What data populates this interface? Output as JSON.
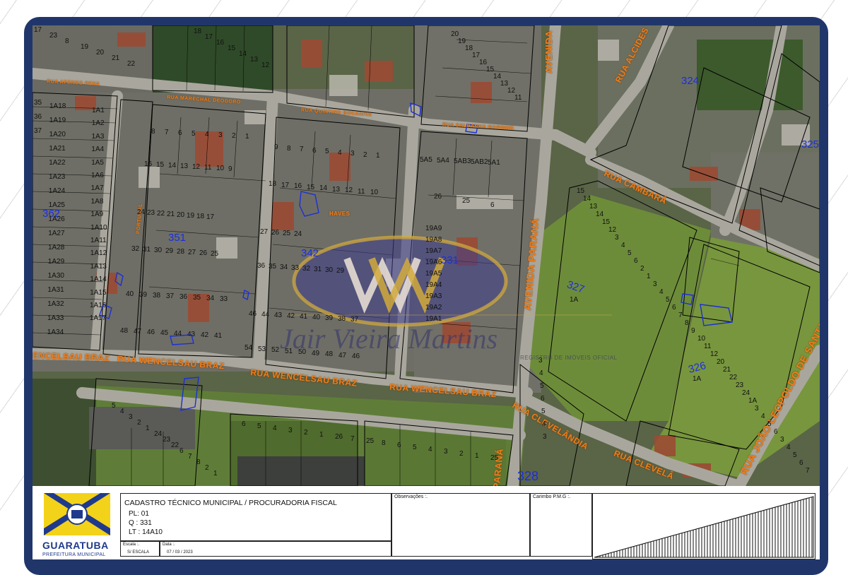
{
  "map": {
    "streets": [
      {
        "id": "rua-afonso-pena-top",
        "text": "RUA AFONSO PENA"
      },
      {
        "id": "rua-marechal",
        "text": "RUA MARECHAL DEODORO"
      },
      {
        "id": "rua-quintino",
        "text": "RUA QUINTINO BOCAIUVA"
      },
      {
        "id": "rua-saldanha",
        "text": "RUA SALDANHA MARINHO"
      },
      {
        "id": "rua-wencelsau-1",
        "text": "RUA WENCELSAU BRAZ"
      },
      {
        "id": "rua-wencelsau-2",
        "text": "RUA WENCELSAU BRAZ"
      },
      {
        "id": "rua-wencelsau-3",
        "text": "RUA WENCELSAU BRAZ"
      },
      {
        "id": "rua-wencelsau-left",
        "text": "ENCELSAU BRAZ"
      },
      {
        "id": "avenida-parana",
        "text": "AVENIDA PARANÁ"
      },
      {
        "id": "avenida-top",
        "text": "AVENIDA"
      },
      {
        "id": "rua-cambara",
        "text": "RUA CAMBARÁ"
      },
      {
        "id": "rua-cleveland-1",
        "text": "RUA CLEVELÂNDIA"
      },
      {
        "id": "rua-cleveland-2",
        "text": "RUA CLEVELÂ"
      },
      {
        "id": "rua-joao-leopoldo",
        "text": "RUA JOÃO LEOPOLDO DE SANTANA"
      },
      {
        "id": "rua-alcides",
        "text": "RUA ALCIDES"
      },
      {
        "id": "rua-haves",
        "text": "HAVES"
      },
      {
        "id": "rua-portugal",
        "text": "PORTUGAL"
      },
      {
        "id": "parana-bottom",
        "text": "PARANÁ"
      }
    ],
    "blocks": [
      {
        "id": "b362",
        "text": "362"
      },
      {
        "id": "b351",
        "text": "351"
      },
      {
        "id": "b342",
        "text": "342"
      },
      {
        "id": "b331",
        "text": "331"
      },
      {
        "id": "b327",
        "text": "327"
      },
      {
        "id": "b327-1a",
        "text": "1A"
      },
      {
        "id": "b326",
        "text": "326"
      },
      {
        "id": "b326-1a",
        "text": "1A"
      },
      {
        "id": "b324",
        "text": "324"
      },
      {
        "id": "b325",
        "text": "325"
      },
      {
        "id": "b328",
        "text": "328"
      }
    ],
    "lot_labels_left_col": [
      "1A18",
      "1A19",
      "1A20",
      "1A21",
      "1A22",
      "1A23",
      "1A24",
      "1A25",
      "1A26",
      "1A27",
      "1A28",
      "1A29",
      "1A30",
      "1A31",
      "1A32",
      "1A33",
      "1A34"
    ],
    "lot_labels_col2": [
      "1A1",
      "1A2",
      "1A3",
      "1A4",
      "1A5",
      "1A6",
      "1A7",
      "1A8",
      "1A9",
      "1A10",
      "1A11",
      "1A12",
      "1A13",
      "1A14",
      "1A15",
      "1A16",
      "1A17"
    ],
    "lot_labels_left_nums": [
      "35",
      "36",
      "37"
    ],
    "row_351_top": [
      "24",
      "23",
      "22",
      "21",
      "20",
      "19",
      "18",
      "17"
    ],
    "row_351_mid": [
      "32",
      "31",
      "30",
      "29",
      "28",
      "27",
      "26",
      "25"
    ],
    "row_351_low": [
      "40",
      "39",
      "38",
      "37",
      "36",
      "35",
      "34",
      "33"
    ],
    "row_351_bottom": [
      "48",
      "47",
      "46",
      "45",
      "44",
      "43",
      "42",
      "41"
    ],
    "row_upper_left": [
      "8",
      "7",
      "6",
      "5",
      "4",
      "3",
      "2",
      "1"
    ],
    "row_upper_left2": [
      "16",
      "15",
      "14",
      "13",
      "12",
      "11",
      "10",
      "9"
    ],
    "row_mid_top": [
      "9",
      "8",
      "7",
      "6",
      "5",
      "4",
      "3",
      "2",
      "1"
    ],
    "row_mid_top2": [
      "18",
      "17",
      "16",
      "15",
      "14",
      "13",
      "12",
      "11",
      "10"
    ],
    "row_342_a": [
      "27",
      "26",
      "25",
      "24"
    ],
    "row_342_b": [
      "36",
      "35",
      "34",
      "33",
      "32",
      "31",
      "30",
      "29"
    ],
    "row_342_c": [
      "46",
      "44",
      "43",
      "42",
      "41",
      "40",
      "39",
      "38",
      "37"
    ],
    "row_342_d": [
      "54",
      "53",
      "52",
      "51",
      "50",
      "49",
      "48",
      "47",
      "46"
    ],
    "row_331_right": [
      "19A9",
      "19A8",
      "19A7",
      "19A6",
      "19A5",
      "19A4",
      "19A3",
      "19A2",
      "19A1"
    ],
    "row_331_top": [
      "5A5",
      "5A4",
      "5AB3",
      "5AB2",
      "5A1"
    ],
    "row_331_misc": [
      "26",
      "25",
      "6",
      "7",
      "8",
      "9",
      "10",
      "11",
      "12",
      "13",
      "14A1",
      "14A2",
      "14A3",
      "14A4",
      "14A5",
      "14A6",
      "14A7",
      "14A8",
      "14A9",
      "14A10"
    ],
    "row_top_middle": [
      "20",
      "19",
      "18",
      "17",
      "16",
      "15",
      "14",
      "13",
      "12",
      "11"
    ],
    "row_top_left": [
      "17",
      "23",
      "8",
      "19",
      "20",
      "21",
      "22"
    ],
    "row_top_left2": [
      "18",
      "17",
      "16",
      "15",
      "14",
      "13",
      "12"
    ],
    "row_bottom_left": [
      "5",
      "4",
      "3",
      "2",
      "1",
      "24",
      "23",
      "22",
      "6",
      "7",
      "8",
      "2",
      "1"
    ],
    "row_bottom_mid": [
      "6",
      "5",
      "4",
      "3",
      "2",
      "1",
      "26",
      "7",
      "25",
      "8",
      "6",
      "5",
      "4",
      "3",
      "2",
      "1",
      "25"
    ],
    "right_lots": [
      "15",
      "14",
      "13",
      "14",
      "15",
      "12",
      "3",
      "4",
      "5",
      "6",
      "2",
      "1",
      "3",
      "4",
      "5",
      "6",
      "7",
      "8",
      "9",
      "10",
      "11",
      "12",
      "20",
      "21",
      "22",
      "23",
      "24",
      "1A",
      "3",
      "4",
      "5",
      "6",
      "3",
      "4",
      "5",
      "6",
      "7"
    ],
    "bottom_center_lots": [
      "3",
      "4",
      "5",
      "6",
      "5",
      "4",
      "3"
    ]
  },
  "watermark": {
    "text": "Jair Vieira Martins",
    "sub": "REGISTRO DE IMÓVEIS OFICIAL"
  },
  "titleblock": {
    "title": "CADASTRO TÉCNICO MUNICIPAL / PROCURADORIA FISCAL",
    "pl": "PL: 01",
    "q": "Q : 331",
    "lt": "LT : 14A10",
    "escala_label": "Escala :.",
    "escala_value": "S/ ESCALA",
    "data_label": "Data :.",
    "data_value": "07 / 03 / 2023",
    "observacoes": "Observações :.",
    "carimbo": "Carimbo P.M.G :.",
    "logo_name": "GUARATUBA",
    "logo_sub": "PREFEITURA MUNICIPAL"
  },
  "colors": {
    "frame": "#20366b",
    "street_label": "#f07d1c",
    "block_label": "#1b2ee0",
    "aerial": "#4e5a3f"
  }
}
